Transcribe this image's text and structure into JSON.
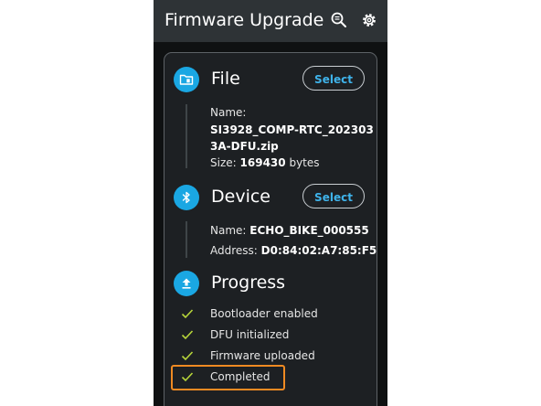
{
  "app_bar": {
    "title": "Firmware Upgrade",
    "icons": [
      "search-list-icon",
      "gear-icon"
    ]
  },
  "file": {
    "title": "File",
    "select_label": "Select",
    "name_label": "Name:",
    "name_line1": "SI3928_COMP-RTC_202303",
    "name_line2": "3A-DFU.zip",
    "size_label": "Size:",
    "size_value": "169430",
    "size_unit": "bytes",
    "icon": "folder-sim-icon"
  },
  "device": {
    "title": "Device",
    "select_label": "Select",
    "name_label": "Name:",
    "name_value": "ECHO_BIKE_000555",
    "address_label": "Address:",
    "address_value": "D0:84:02:A7:85:F5",
    "icon": "bluetooth-icon"
  },
  "progress": {
    "title": "Progress",
    "icon": "upload-icon",
    "steps": [
      "Bootloader enabled",
      "DFU initialized",
      "Firmware uploaded",
      "Completed"
    ]
  },
  "colors": {
    "accent": "#1aa7e3",
    "check": "#b7d53a",
    "highlight": "#ef8a22",
    "background": "#0f1112"
  }
}
